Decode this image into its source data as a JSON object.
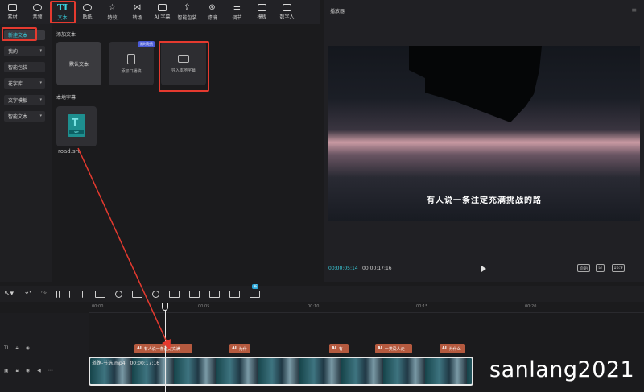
{
  "toolbar": {
    "items": [
      {
        "label": "素材",
        "icon": "media-icon"
      },
      {
        "label": "音频",
        "icon": "audio-icon"
      },
      {
        "label": "文本",
        "icon": "text-icon",
        "glyph": "TI"
      },
      {
        "label": "贴纸",
        "icon": "sticker-icon"
      },
      {
        "label": "特效",
        "icon": "effects-icon"
      },
      {
        "label": "转场",
        "icon": "transition-icon"
      },
      {
        "label": "AI 字幕",
        "icon": "ai-caption-icon"
      },
      {
        "label": "智能包装",
        "icon": "smart-package-icon"
      },
      {
        "label": "滤镜",
        "icon": "filter-icon"
      },
      {
        "label": "调节",
        "icon": "adjust-icon"
      },
      {
        "label": "模板",
        "icon": "template-icon"
      },
      {
        "label": "数字人",
        "icon": "digital-human-icon"
      }
    ]
  },
  "sidebar": {
    "items": [
      {
        "label": "新建文本",
        "has_chevron": false
      },
      {
        "label": "我的",
        "has_chevron": true
      },
      {
        "label": "智能包装",
        "has_chevron": false
      },
      {
        "label": "花字库",
        "has_chevron": true
      },
      {
        "label": "文字模板",
        "has_chevron": true
      },
      {
        "label": "智能文本",
        "has_chevron": true
      }
    ]
  },
  "content": {
    "add_text_title": "添加文本",
    "default_text": "默认文本",
    "add_voiceover": "添加口播稿",
    "voiceover_badge": "限时免费",
    "import_subtitle": "导入本地字幕",
    "local_subtitle_title": "本地字幕",
    "srt_tag": "SRT",
    "srt_file": "road.srt"
  },
  "player": {
    "title": "播放器",
    "subtitle_text": "有人说一条注定充满挑战的路",
    "current_time": "00:00:05:14",
    "total_time": "00:00:17:16",
    "ratio_label": "原始",
    "aspect": "16:9"
  },
  "timeline": {
    "ruler_ticks": [
      "00:00",
      "00:05",
      "00:10",
      "00:15",
      "00:20"
    ],
    "tool_badge": "新",
    "subtitle_clips": [
      {
        "text": "有人说一条注定充满"
      },
      {
        "text": "为什"
      },
      {
        "text": "有"
      },
      {
        "text": "一类没人走"
      },
      {
        "text": "为什么"
      }
    ],
    "video_clip": {
      "name": "道路-节选.mp4",
      "duration": "00:00:17:16"
    }
  },
  "watermark": "sanlang2021",
  "colors": {
    "accent": "#3ad1e0",
    "highlight": "#e53a2f",
    "subtitle_clip": "#b55a3f"
  }
}
